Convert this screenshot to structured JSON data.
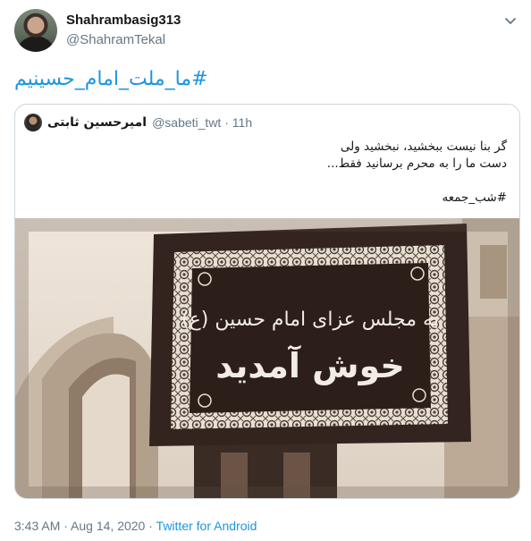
{
  "tweet": {
    "author_name": "Shahrambasig313",
    "author_handle": "@ShahramTekal",
    "avatar_icon": "user-avatar",
    "menu_icon": "chevron-down-icon",
    "hashtag": "#ما_ملت_امام_حسینیم"
  },
  "quoted": {
    "author_name": "امیرحسین ثابتی",
    "author_handle": "@sabeti_twt",
    "separator": " · ",
    "time": "11h",
    "text_line1": "گر بنا نیست ببخشید، نبخشید ولی",
    "text_line2": "دست ما را به محرم برسانید فقط...",
    "hashtag": "#شب_جمعه",
    "image": {
      "banner_line1": "به مجلس عزای امام حسین (ع)",
      "banner_line2": "خوش آمدید"
    }
  },
  "footer": {
    "time": "3:43 AM",
    "sep1": " · ",
    "date": "Aug 14, 2020",
    "sep2": " · ",
    "source": "Twitter for Android"
  },
  "colors": {
    "link": "#1b95e0",
    "muted": "#657786",
    "border": "#ccd6dd"
  }
}
